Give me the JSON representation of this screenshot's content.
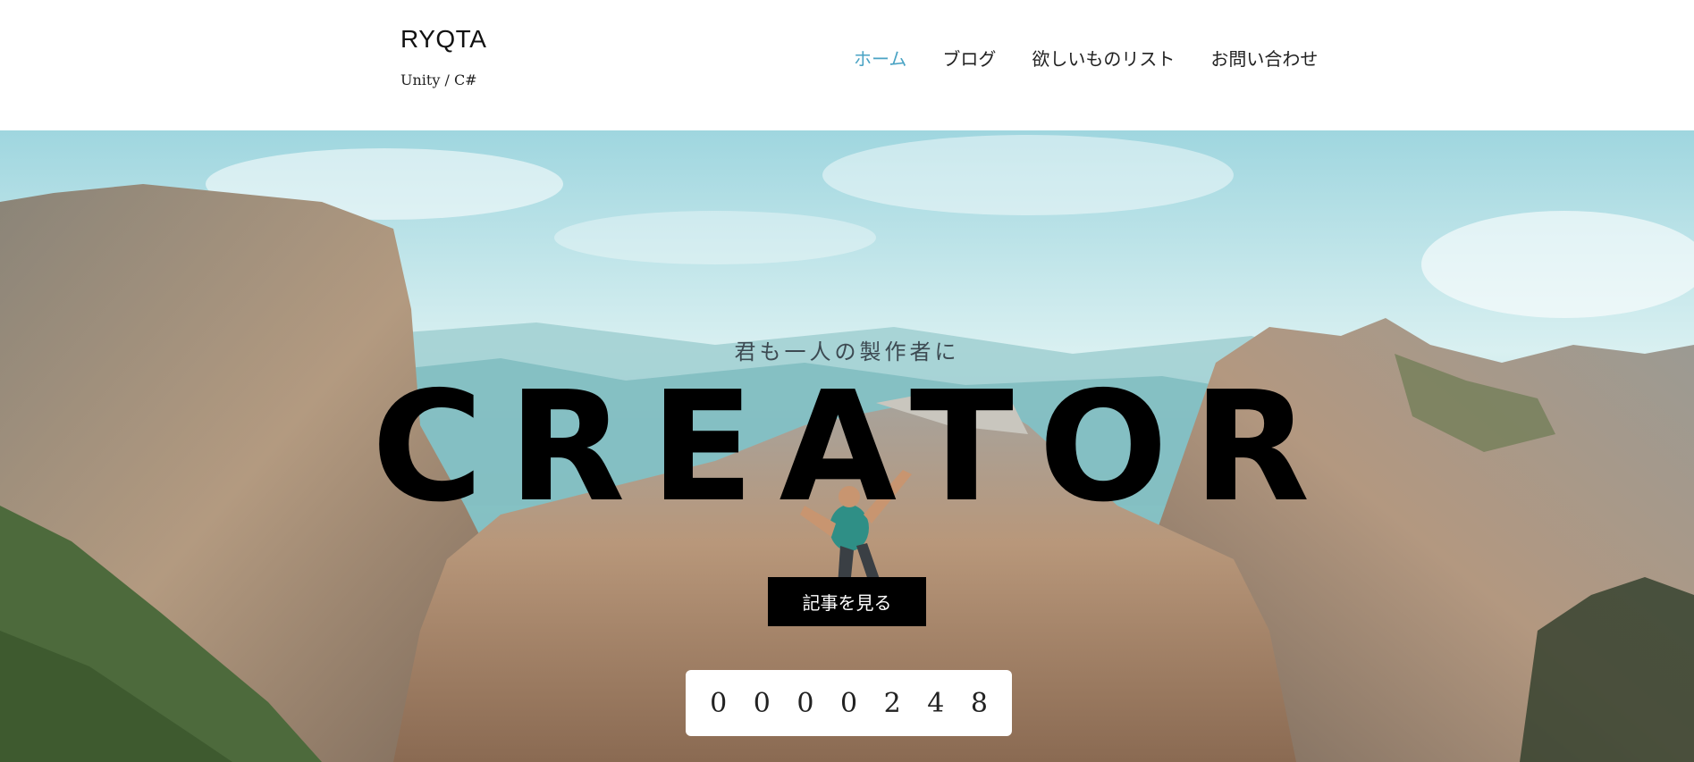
{
  "header": {
    "site_title": "RYQTA",
    "tagline": "Unity / C#",
    "nav": [
      {
        "label": "ホーム",
        "active": true
      },
      {
        "label": "ブログ",
        "active": false
      },
      {
        "label": "欲しいものリスト",
        "active": false
      },
      {
        "label": "お問い合わせ",
        "active": false
      }
    ]
  },
  "hero": {
    "subtitle": "君も一人の製作者に",
    "title": "CREATOR",
    "cta_label": "記事を見る",
    "counter_digits": [
      "0",
      "0",
      "0",
      "0",
      "2",
      "4",
      "8"
    ]
  },
  "colors": {
    "nav_active": "#4aa3c4",
    "cta_background": "#000000",
    "sky": "#bfe6ea"
  }
}
